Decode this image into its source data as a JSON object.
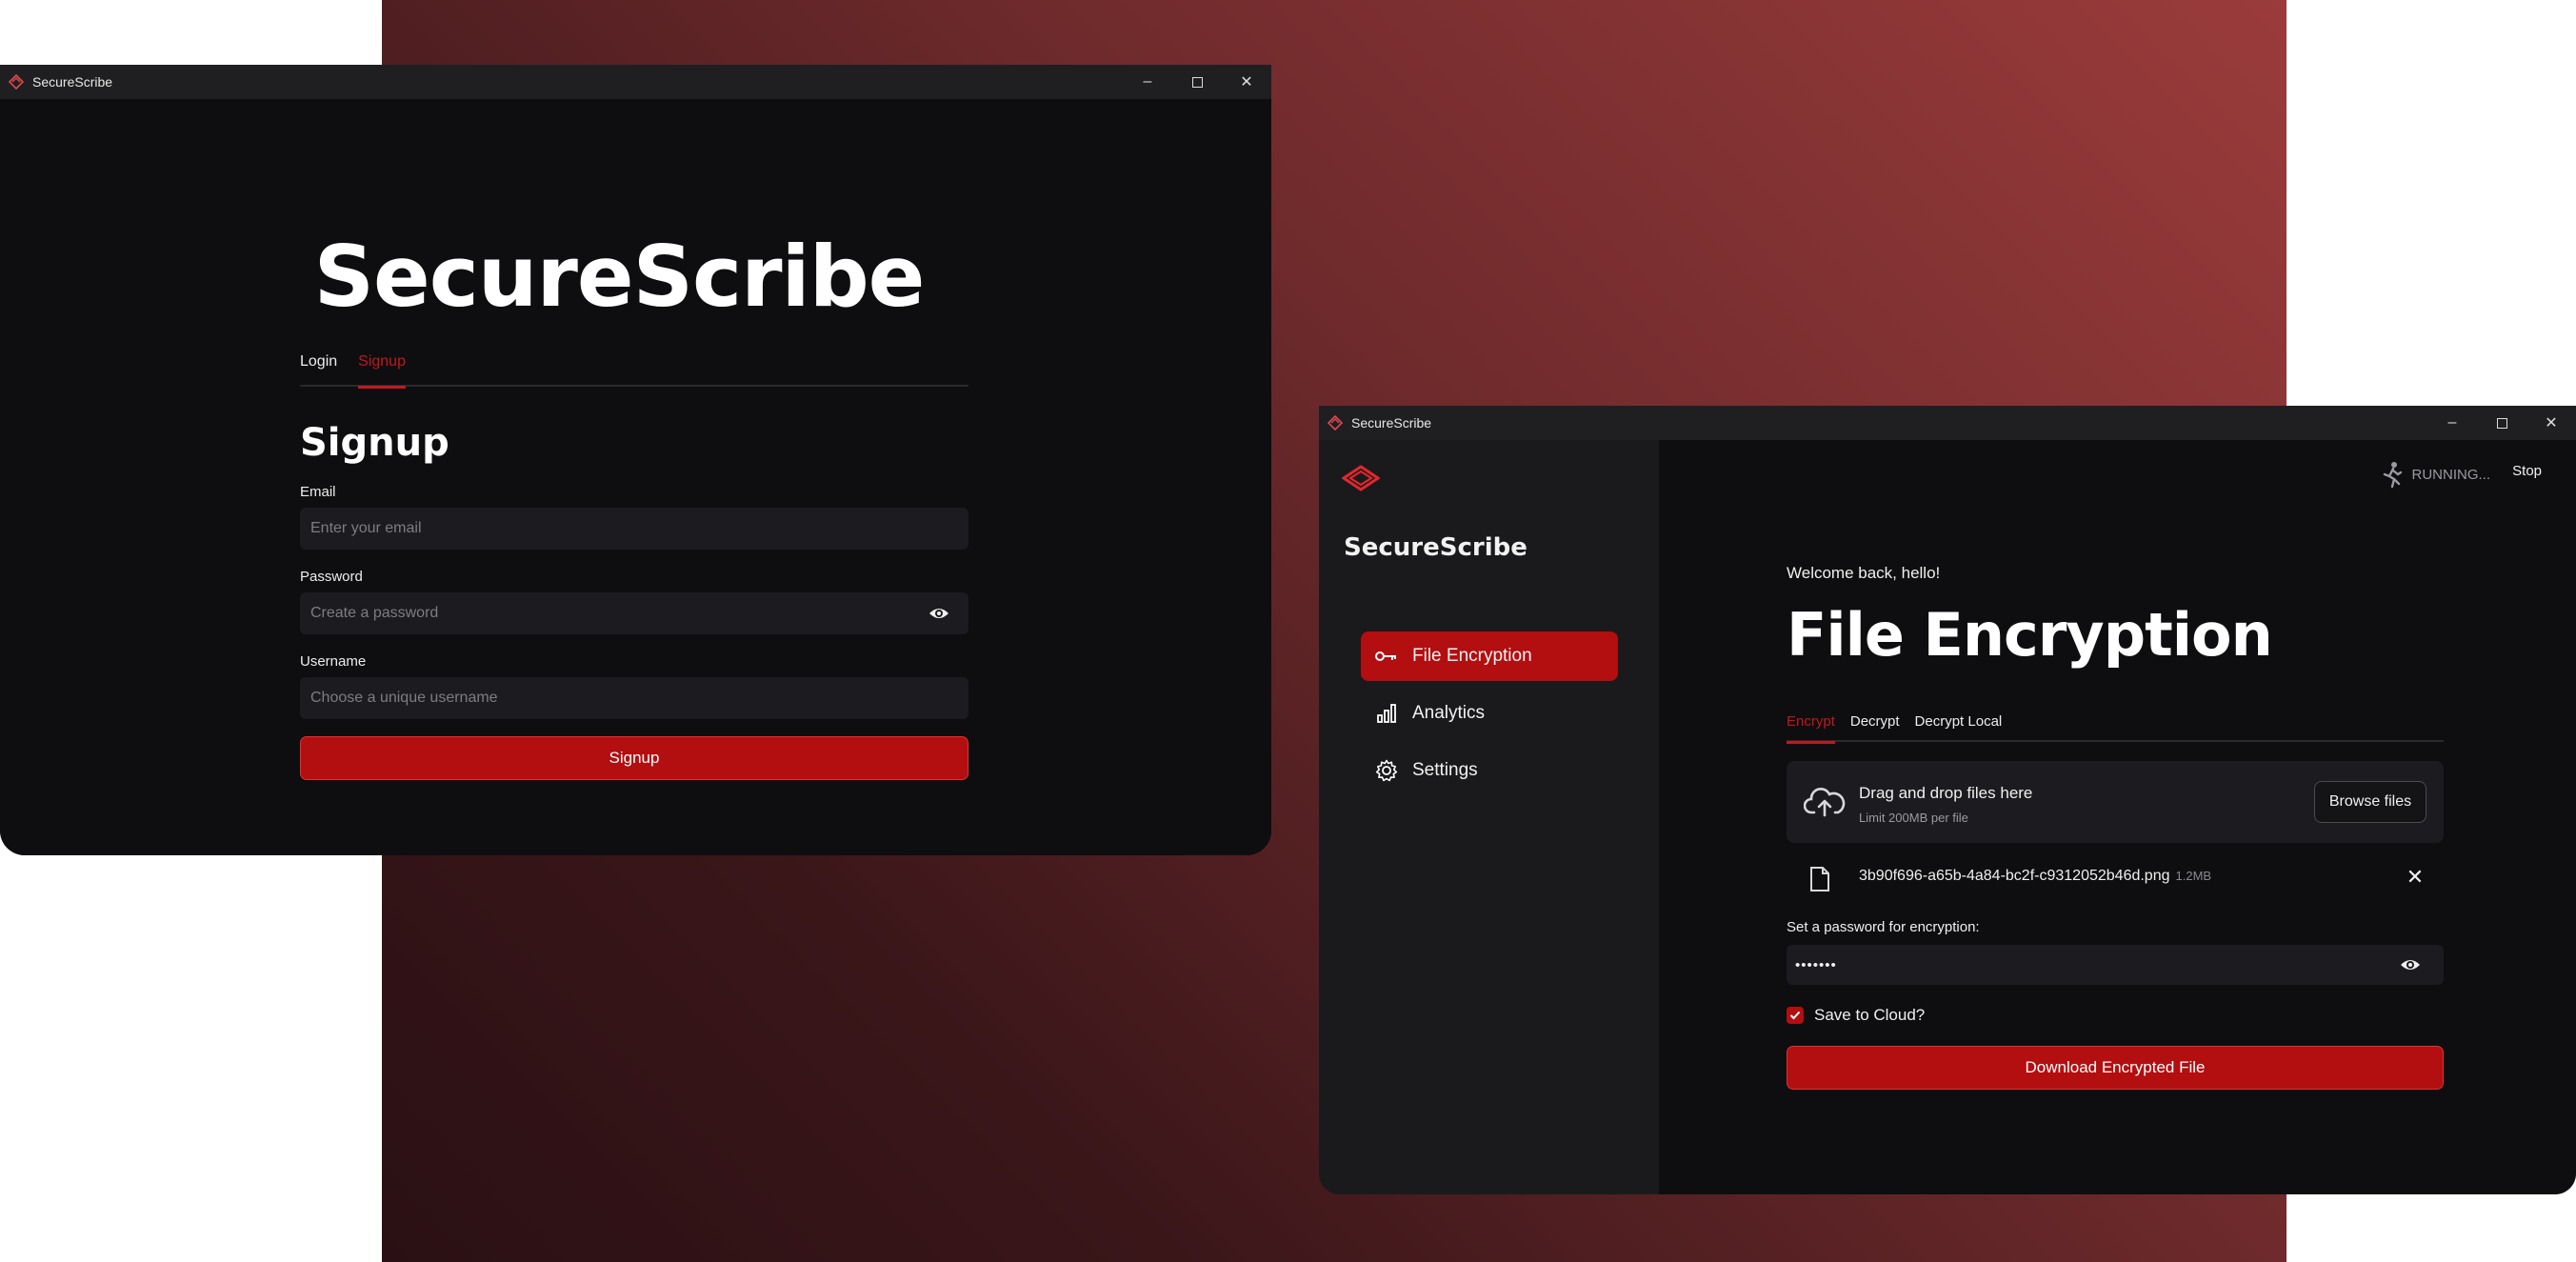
{
  "login_window": {
    "title": "SecureScribe",
    "brand": "SecureScribe",
    "tabs": [
      {
        "label": "Login",
        "active": false
      },
      {
        "label": "Signup",
        "active": true
      }
    ],
    "form_title": "Signup",
    "fields": {
      "email": {
        "label": "Email",
        "placeholder": "Enter your email"
      },
      "password": {
        "label": "Password",
        "placeholder": "Create a password"
      },
      "username": {
        "label": "Username",
        "placeholder": "Choose a unique username"
      }
    },
    "submit_label": "Signup"
  },
  "app_window": {
    "title": "SecureScribe",
    "sidebar": {
      "brand": "SecureScribe",
      "items": [
        {
          "label": "File Encryption",
          "icon": "key-icon",
          "active": true
        },
        {
          "label": "Analytics",
          "icon": "bar-chart-icon",
          "active": false
        },
        {
          "label": "Settings",
          "icon": "gear-icon",
          "active": false
        }
      ]
    },
    "status": {
      "running_label": "RUNNING...",
      "stop_label": "Stop"
    },
    "welcome": "Welcome back, hello!",
    "page_title": "File Encryption",
    "tabs": [
      {
        "label": "Encrypt",
        "active": true
      },
      {
        "label": "Decrypt",
        "active": false
      },
      {
        "label": "Decrypt Local",
        "active": false
      }
    ],
    "uploader": {
      "title": "Drag and drop files here",
      "subtitle": "Limit 200MB per file",
      "browse_label": "Browse files"
    },
    "file": {
      "name": "3b90f696-a65b-4a84-bc2f-c9312052b46d.png",
      "size": "1.2MB"
    },
    "password": {
      "label": "Set a password for encryption:",
      "value": "•••••••"
    },
    "save_to_cloud": {
      "label": "Save to Cloud?",
      "checked": true
    },
    "download_label": "Download Encrypted File"
  },
  "colors": {
    "accent": "#b30e10",
    "background": "#0e0e11",
    "sidebar": "#1a1a1d"
  }
}
